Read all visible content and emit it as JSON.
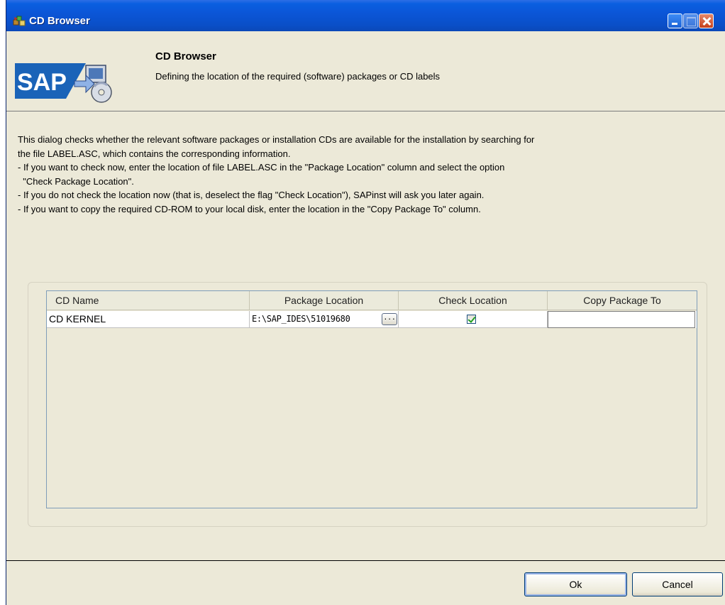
{
  "window": {
    "title": "CD Browser",
    "controls": [
      "minimize",
      "maximize",
      "close"
    ]
  },
  "header": {
    "title": "CD Browser",
    "subtitle": "Defining the location of the required (software) packages or CD labels",
    "logo_text": "SAP"
  },
  "description": [
    "This dialog checks whether the relevant software packages or installation CDs are available for the installation by searching for",
    "the file LABEL.ASC, which contains the corresponding information.",
    "- If you want to check now, enter the location of file LABEL.ASC in the \"Package Location\" column and select the option",
    "  \"Check Package Location\".",
    "- If you do not check the location now (that is, deselect the flag \"Check Location\"), SAPinst will ask you later again.",
    "- If you want to copy the required CD-ROM to your local disk, enter the location in the \"Copy Package To\" column."
  ],
  "table": {
    "columns": [
      "CD Name",
      "Package Location",
      "Check Location",
      "Copy Package To"
    ],
    "rows": [
      {
        "cd_name": "CD KERNEL",
        "package_location": "E:\\SAP_IDES\\51019680",
        "browse_label": "...",
        "check_location": true,
        "copy_package_to": ""
      }
    ]
  },
  "buttons": {
    "ok": "Ok",
    "cancel": "Cancel"
  }
}
